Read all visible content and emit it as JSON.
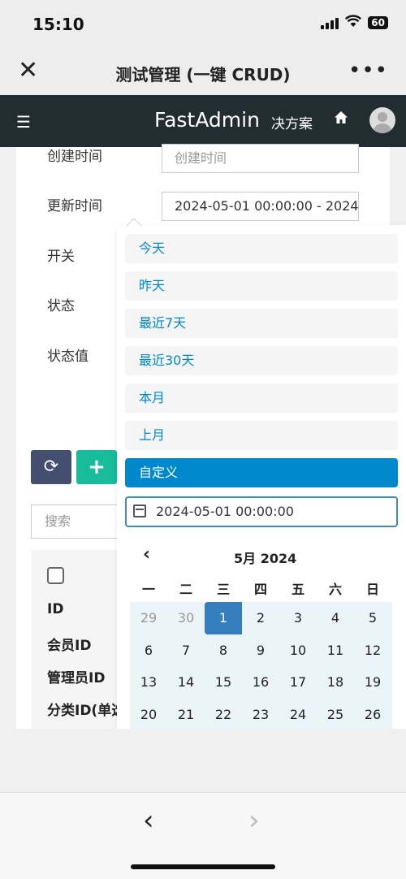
{
  "status": {
    "time": "15:10",
    "battery": "60"
  },
  "nav": {
    "title": "测试管理 (一键 CRUD)",
    "close": "✕",
    "more": "•••"
  },
  "header": {
    "brand": "FastAdmin",
    "menu": "决方案",
    "hamburger": "☰",
    "home": "⌂"
  },
  "form": {
    "fields": [
      {
        "label": "创建时间",
        "placeholder": "创建时间"
      },
      {
        "label": "更新时间",
        "value": "2024-05-01 00:00:00 - 2024"
      },
      {
        "label": "开关"
      },
      {
        "label": "状态"
      },
      {
        "label": "状态值"
      }
    ]
  },
  "toolbar": {
    "refresh": "⟳",
    "add": "+",
    "search_placeholder": "搜索"
  },
  "table": {
    "columns": [
      "ID",
      "会员ID",
      "管理员ID",
      "分类ID(单选"
    ]
  },
  "daterange": {
    "ranges": [
      "今天",
      "昨天",
      "最近7天",
      "最近30天",
      "本月",
      "上月",
      "自定义"
    ],
    "active_range": "自定义",
    "start_input": "2024-05-01 00:00:00",
    "calendar": {
      "prev": "‹",
      "month_label": "5月 2024",
      "weekdays": [
        "一",
        "二",
        "三",
        "四",
        "五",
        "六",
        "日"
      ],
      "rows": [
        [
          "29",
          "30",
          "1",
          "2",
          "3",
          "4",
          "5"
        ],
        [
          "6",
          "7",
          "8",
          "9",
          "10",
          "11",
          "12"
        ],
        [
          "13",
          "14",
          "15",
          "16",
          "17",
          "18",
          "19"
        ],
        [
          "20",
          "21",
          "22",
          "23",
          "24",
          "25",
          "26"
        ]
      ],
      "selected": "1"
    }
  },
  "browser": {
    "back": "‹",
    "forward": "›"
  },
  "colors": {
    "header_bg": "#222d32",
    "accent": "#0088cc",
    "selected": "#357ebd",
    "add_btn": "#18bc9c",
    "refresh_btn": "#444e6f"
  }
}
